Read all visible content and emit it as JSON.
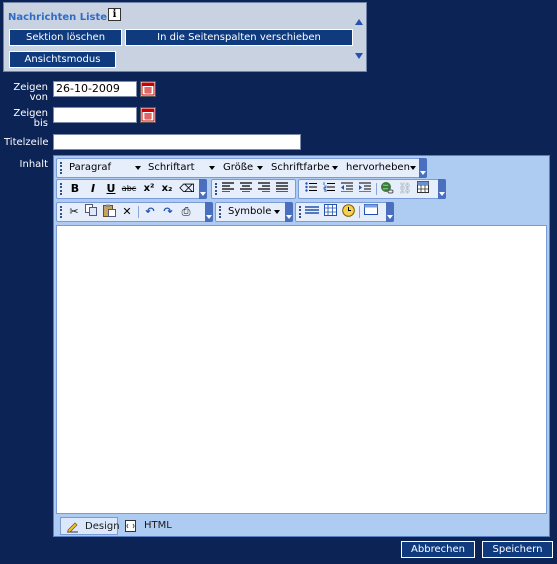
{
  "panel": {
    "title": "Nachrichten Liste",
    "info_icon": "info-icon",
    "buttons": {
      "delete_section": "Sektion löschen",
      "move_to_sidebar": "In die Seitenspalten verschieben",
      "view_mode": "Ansichtsmodus"
    }
  },
  "form": {
    "show_from": {
      "label_line1": "Zeigen",
      "label_line2": "von",
      "value": "26-10-2009"
    },
    "show_to": {
      "label_line1": "Zeigen",
      "label_line2": "bis",
      "value": ""
    },
    "title_line": {
      "label": "Titelzeile",
      "value": ""
    },
    "content": {
      "label": "Inhalt"
    }
  },
  "editor": {
    "dropdowns": {
      "paragraph": "Paragraf",
      "font": "Schriftart",
      "size": "Größe",
      "font_color": "Schriftfarbe",
      "highlight": "hervorheben",
      "symbols": "Symbole"
    },
    "icons": {
      "bold": "B",
      "italic": "I",
      "underline": "U",
      "strike": "abc",
      "superscript": "x²",
      "subscript": "x₂",
      "eraser": "⌫",
      "cut": "✂",
      "copy": "⧉",
      "paste": "📋",
      "delete": "✕",
      "undo": "↶",
      "redo": "↷",
      "print": "⎙",
      "link": "🔗",
      "unlink": "⛓",
      "table": "▦"
    },
    "modes": {
      "design": "Design",
      "html": "HTML"
    },
    "colors": {
      "toolbar_bg": "#e6eefc",
      "editor_bg": "#aeccf2"
    }
  },
  "actions": {
    "cancel": "Abbrechen",
    "save": "Speichern"
  },
  "colors": {
    "page_bg": "#0c2356",
    "button_bg": "#0f3a7e",
    "panel_bg": "#c9d2e1",
    "title_color": "#2f6cc8"
  }
}
